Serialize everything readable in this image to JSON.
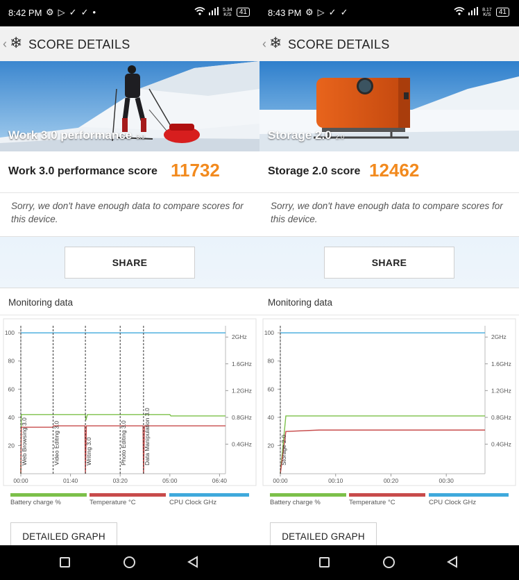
{
  "colors": {
    "accent_score": "#f28a1e",
    "battery": "#7cc04a",
    "temperature": "#c74b4b",
    "cpu": "#3fa9dc"
  },
  "panels": [
    {
      "status": {
        "time": "8:42 PM",
        "net_speed": "5.34",
        "net_unit": "K/S",
        "battery": "41"
      },
      "title": "SCORE DETAILS",
      "hero_caption": "Work 3.0 performance",
      "hero_caption_small": "3.0",
      "score_label": "Work 3.0 performance score",
      "score_value": "11732",
      "sorry_text": "Sorry, we don't have enough data to compare scores for this device.",
      "share_label": "SHARE",
      "monitoring_label": "Monitoring data",
      "chart_data": {
        "type": "line",
        "title": "",
        "x_ticks": [
          "00:00",
          "01:40",
          "03:20",
          "05:00",
          "06:40"
        ],
        "x_tick_minutes": [
          0,
          100,
          200,
          300,
          400
        ],
        "x_max_minutes": 412,
        "y_ticks": [
          "100",
          "80",
          "60",
          "40",
          "20"
        ],
        "y_range": [
          0,
          105
        ],
        "y2_ticks": [
          "2GHz",
          "1.6GHz",
          "1.2GHz",
          "0.8GHz",
          "0.4GHz"
        ],
        "y2_tick_ghz": [
          2.0,
          1.6,
          1.2,
          0.8,
          0.4
        ],
        "markers": [
          {
            "label": "Web Browsing 3.0",
            "x": 0
          },
          {
            "label": "Video Editing 3.0",
            "x": 65
          },
          {
            "label": "Writing 3.0",
            "x": 130
          },
          {
            "label": "Photo Editing 3.0",
            "x": 200
          },
          {
            "label": "Data Manipulation 3.0",
            "x": 247
          }
        ],
        "series": [
          {
            "name": "Battery charge %",
            "color": "#7cc04a",
            "points": [
              [
                0,
                0
              ],
              [
                1,
                42
              ],
              [
                130,
                42
              ],
              [
                131,
                38
              ],
              [
                134,
                42
              ],
              [
                300,
                42
              ],
              [
                302,
                41
              ],
              [
                412,
                41
              ]
            ]
          },
          {
            "name": "Temperature °C",
            "color": "#c74b4b",
            "points": [
              [
                0,
                0
              ],
              [
                1,
                33
              ],
              [
                64,
                33
              ],
              [
                66,
                34
              ],
              [
                129,
                34
              ],
              [
                130,
                0
              ],
              [
                132,
                34
              ],
              [
                246,
                34
              ],
              [
                247,
                0
              ],
              [
                249,
                34
              ],
              [
                412,
                34
              ]
            ]
          },
          {
            "name": "CPU Clock GHz",
            "color": "#3fa9dc",
            "points": [
              [
                0,
                100
              ],
              [
                412,
                100
              ]
            ]
          }
        ]
      },
      "legend": [
        "Battery charge %",
        "Temperature °C",
        "CPU Clock GHz"
      ],
      "detailed_label": "DETAILED GRAPH"
    },
    {
      "status": {
        "time": "8:43 PM",
        "net_speed": "8.17",
        "net_unit": "K/S",
        "battery": "41"
      },
      "title": "SCORE DETAILS",
      "hero_caption": "Storage 2.0",
      "hero_caption_small": "2.0",
      "score_label": "Storage 2.0 score",
      "score_value": "12462",
      "sorry_text": "Sorry, we don't have enough data to compare scores for this device.",
      "share_label": "SHARE",
      "monitoring_label": "Monitoring data",
      "chart_data": {
        "type": "line",
        "title": "",
        "x_ticks": [
          "00:00",
          "00:10",
          "00:20",
          "00:30"
        ],
        "x_tick_minutes": [
          0,
          10,
          20,
          30
        ],
        "x_max_minutes": 37,
        "y_ticks": [
          "100",
          "80",
          "60",
          "40",
          "20"
        ],
        "y_range": [
          0,
          105
        ],
        "y2_ticks": [
          "2GHz",
          "1.6GHz",
          "1.2GHz",
          "0.8GHz",
          "0.4GHz"
        ],
        "y2_tick_ghz": [
          2.0,
          1.6,
          1.2,
          0.8,
          0.4
        ],
        "markers": [
          {
            "label": "Storage 2.0",
            "x": 0
          }
        ],
        "series": [
          {
            "name": "Battery charge %",
            "color": "#7cc04a",
            "points": [
              [
                0,
                0
              ],
              [
                1,
                41
              ],
              [
                37,
                41
              ]
            ]
          },
          {
            "name": "Temperature °C",
            "color": "#c74b4b",
            "points": [
              [
                0,
                0
              ],
              [
                1,
                30
              ],
              [
                7,
                31
              ],
              [
                37,
                31
              ]
            ]
          },
          {
            "name": "CPU Clock GHz",
            "color": "#3fa9dc",
            "points": [
              [
                0,
                100
              ],
              [
                37,
                100
              ]
            ]
          }
        ]
      },
      "legend": [
        "Battery charge %",
        "Temperature °C",
        "CPU Clock GHz"
      ],
      "detailed_label": "DETAILED GRAPH"
    }
  ]
}
